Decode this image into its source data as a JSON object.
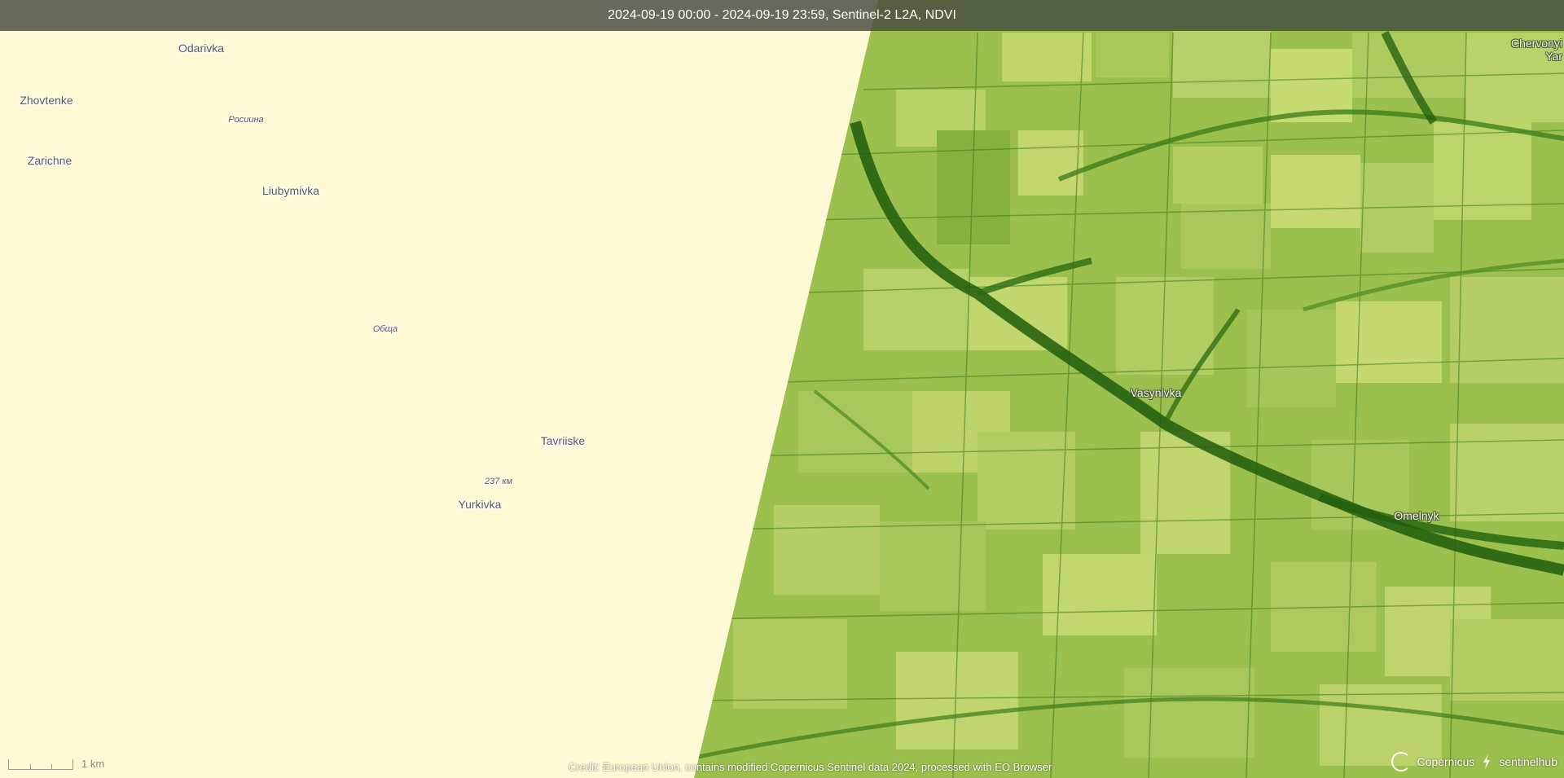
{
  "header": {
    "title": "2024-09-19 00:00 - 2024-09-19 23:59, Sentinel-2 L2A, NDVI"
  },
  "colors": {
    "no_data": "#fffad6",
    "ndvi_low": "#b5cf5f",
    "ndvi_mid": "#86b13f",
    "ndvi_high": "#1f5c0c",
    "header_bg": "#4a5040"
  },
  "places": {
    "odarivka": "Odarivka",
    "zhovtenke": "Zhovtenke",
    "roschina": "Росиина",
    "zarichne": "Zarichne",
    "liubymivka": "Liubymivka",
    "obsh": "Обща",
    "tavriiske": "Tavriiske",
    "km237": "237 км",
    "yurkivka": "Yurkivka",
    "vasynivka": "Vasynivka",
    "omelnyk": "Omelnyk",
    "chervonyi_yar_1": "Chervonyi",
    "chervonyi_yar_2": "Yar"
  },
  "scale": {
    "label": "1 km"
  },
  "footer": {
    "credit": "Credit: European Union, contains modified Copernicus Sentinel data 2024, processed with EO Browser",
    "logo_copernicus": "Copernicus",
    "logo_sentinelhub": "sentinelhub"
  }
}
